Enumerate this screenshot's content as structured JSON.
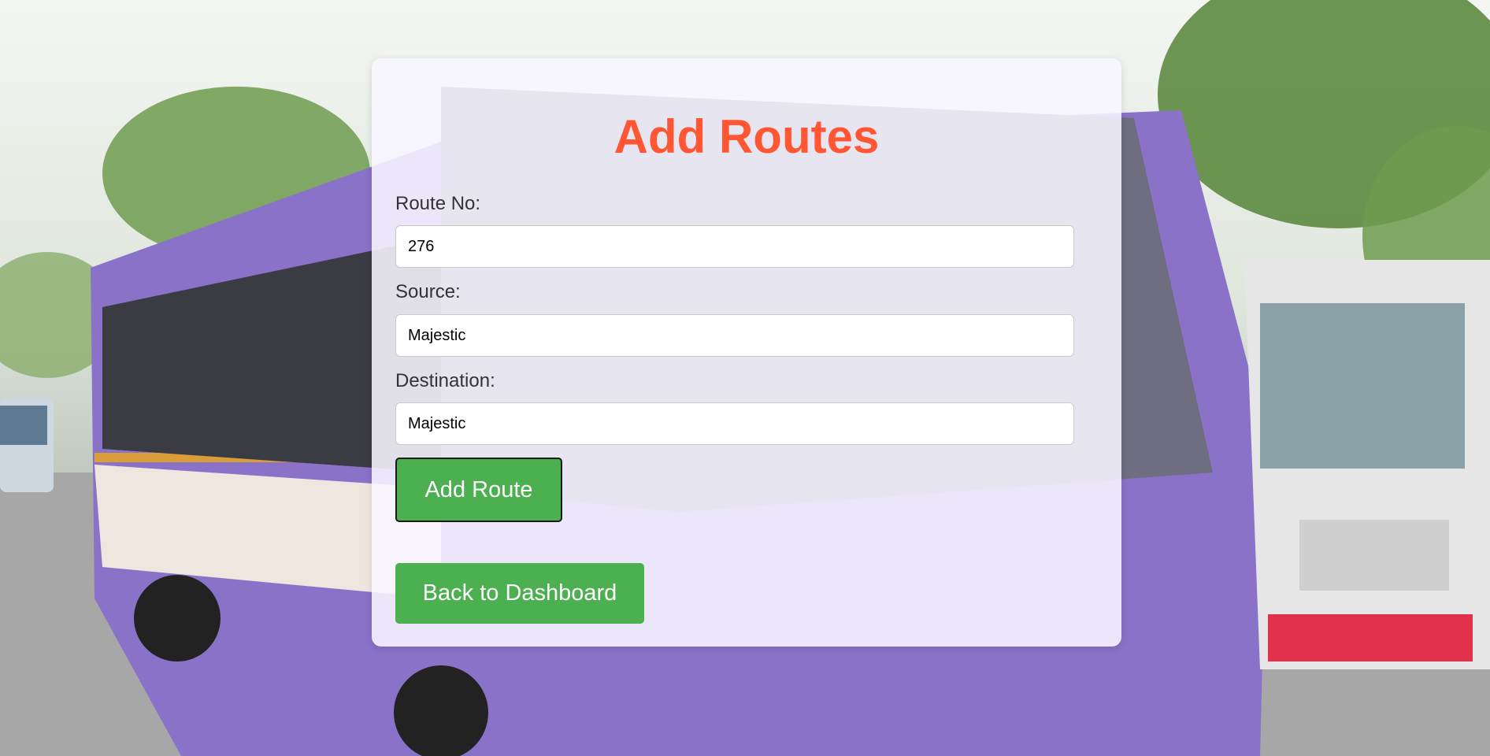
{
  "page": {
    "title": "Add Routes"
  },
  "form": {
    "route_no_label": "Route No:",
    "route_no_value": "276",
    "source_label": "Source:",
    "source_value": "Majestic",
    "destination_label": "Destination:",
    "destination_value": "Majestic",
    "submit_label": "Add Route"
  },
  "nav": {
    "back_label": "Back to Dashboard"
  },
  "colors": {
    "title": "#ff5733",
    "button": "#4caf50"
  },
  "background": {
    "icon": "bus-photo"
  }
}
